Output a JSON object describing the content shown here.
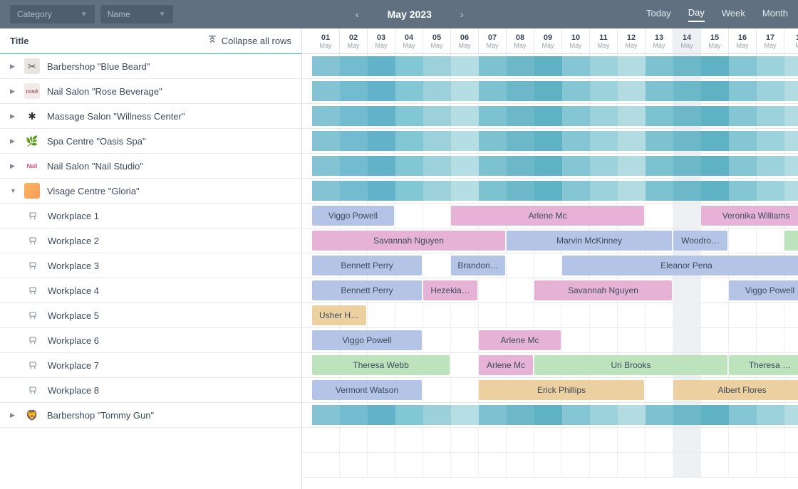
{
  "topbar": {
    "filter1": "Category",
    "filter2": "Name",
    "month": "May 2023",
    "today": "Today",
    "views": [
      "Day",
      "Week",
      "Month"
    ],
    "active_view": "Day"
  },
  "sidebar": {
    "title": "Title",
    "collapse": "Collapse all rows"
  },
  "tree": [
    {
      "label": "Barbershop \"Blue Beard\"",
      "icon": "logo",
      "expanded": false
    },
    {
      "label": "Nail Salon \"Rose Beverage\"",
      "icon": "rose",
      "expanded": false
    },
    {
      "label": "Massage Salon \"Willness Center\"",
      "icon": "massage",
      "expanded": false
    },
    {
      "label": "Spa Centre \"Oasis Spa\"",
      "icon": "spa",
      "expanded": false
    },
    {
      "label": "Nail Salon \"Nail Studio\"",
      "icon": "nail",
      "expanded": false
    },
    {
      "label": "Visage Centre \"Gloria\"",
      "icon": "gloria",
      "expanded": true
    },
    {
      "label": "Workplace 1",
      "icon": "work",
      "sub": true
    },
    {
      "label": "Workplace 2",
      "icon": "work",
      "sub": true
    },
    {
      "label": "Workplace 3",
      "icon": "work",
      "sub": true
    },
    {
      "label": "Workplace 4",
      "icon": "work",
      "sub": true
    },
    {
      "label": "Workplace 5",
      "icon": "work",
      "sub": true
    },
    {
      "label": "Workplace 6",
      "icon": "work",
      "sub": true
    },
    {
      "label": "Workplace 7",
      "icon": "work",
      "sub": true
    },
    {
      "label": "Workplace 8",
      "icon": "work",
      "sub": true
    },
    {
      "label": "Barbershop \"Tommy Gun\"",
      "icon": "gun",
      "expanded": false
    }
  ],
  "days": [
    {
      "num": "01",
      "month": "May"
    },
    {
      "num": "02",
      "month": "May"
    },
    {
      "num": "03",
      "month": "May"
    },
    {
      "num": "04",
      "month": "May"
    },
    {
      "num": "05",
      "month": "May"
    },
    {
      "num": "06",
      "month": "May"
    },
    {
      "num": "07",
      "month": "May"
    },
    {
      "num": "08",
      "month": "May"
    },
    {
      "num": "09",
      "month": "May"
    },
    {
      "num": "10",
      "month": "May"
    },
    {
      "num": "11",
      "month": "May"
    },
    {
      "num": "12",
      "month": "May"
    },
    {
      "num": "13",
      "month": "May"
    },
    {
      "num": "14",
      "month": "May",
      "hl": true
    },
    {
      "num": "15",
      "month": "May"
    },
    {
      "num": "16",
      "month": "May"
    },
    {
      "num": "17",
      "month": "May"
    },
    {
      "num": "1",
      "month": "M"
    }
  ],
  "teal_shades": [
    "#84c3d3",
    "#73bbce",
    "#62b3c9",
    "#81c7d4",
    "#9cd1dc",
    "#b5dde4",
    "#7dc2d0",
    "#6cb8c9",
    "#5fb1c4",
    "#84c6d4",
    "#9cd2db",
    "#b3dce2",
    "#7dc2d0",
    "#6cb8c9",
    "#5fb1c4",
    "#84c6d4",
    "#9cd2db",
    "#b3dce2"
  ],
  "events": {
    "w1": [
      {
        "label": "Viggo Powell",
        "start": 0,
        "span": 3,
        "color": "#b3c4e6"
      },
      {
        "label": "Arlene Mc",
        "start": 5,
        "span": 7,
        "color": "#e6b3d6"
      },
      {
        "label": "Veronika Williams",
        "start": 14,
        "span": 4,
        "color": "#e6b3d6"
      }
    ],
    "w2": [
      {
        "label": "Savannah Nguyen",
        "start": 0,
        "span": 7,
        "color": "#e6b3d6"
      },
      {
        "label": "Marvin McKinney",
        "start": 7,
        "span": 6,
        "color": "#b3c4e6"
      },
      {
        "label": "Woodro…",
        "start": 13,
        "span": 2,
        "color": "#b3c4e6"
      },
      {
        "label": "",
        "start": 17,
        "span": 1,
        "color": "#bde3bd"
      }
    ],
    "w3": [
      {
        "label": "Bennett Perry",
        "start": 0,
        "span": 4,
        "color": "#b3c4e6"
      },
      {
        "label": "Brandon…",
        "start": 5,
        "span": 2,
        "color": "#b3c4e6"
      },
      {
        "label": "Eleanor Pena",
        "start": 9,
        "span": 9,
        "color": "#b3c4e6"
      }
    ],
    "w4": [
      {
        "label": "Bennett Perry",
        "start": 0,
        "span": 4,
        "color": "#b3c4e6"
      },
      {
        "label": "Hezekia…",
        "start": 4,
        "span": 2,
        "color": "#e6b3d6"
      },
      {
        "label": "Savannah Nguyen",
        "start": 8,
        "span": 5,
        "color": "#e6b3d6"
      },
      {
        "label": "Viggo Powell",
        "start": 15,
        "span": 3,
        "color": "#b3c4e6"
      }
    ],
    "w5": [
      {
        "label": "Usher H…",
        "start": 0,
        "span": 2,
        "color": "#ecd0a0"
      }
    ],
    "w6": [
      {
        "label": "Viggo Powell",
        "start": 0,
        "span": 4,
        "color": "#b3c4e6"
      },
      {
        "label": "Arlene Mc",
        "start": 6,
        "span": 3,
        "color": "#e6b3d6"
      }
    ],
    "w7": [
      {
        "label": "Theresa Webb",
        "start": 0,
        "span": 5,
        "color": "#bde3bd"
      },
      {
        "label": "Arlene Mc",
        "start": 6,
        "span": 2,
        "color": "#e6b3d6"
      },
      {
        "label": "Uri Brooks",
        "start": 8,
        "span": 7,
        "color": "#bde3bd"
      },
      {
        "label": "Theresa …",
        "start": 15,
        "span": 3,
        "color": "#bde3bd"
      }
    ],
    "w8": [
      {
        "label": "Vermont Watson",
        "start": 0,
        "span": 4,
        "color": "#b3c4e6"
      },
      {
        "label": "Erick Phillips",
        "start": 6,
        "span": 6,
        "color": "#ecd0a0"
      },
      {
        "label": "Albert Flores",
        "start": 13,
        "span": 5,
        "color": "#ecd0a0"
      }
    ]
  }
}
